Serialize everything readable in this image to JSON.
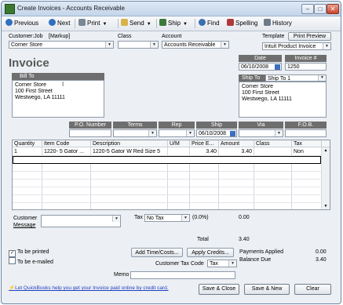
{
  "window": {
    "title": "Create Invoices - Accounts Receivable",
    "controls": {
      "minimize": "–",
      "maximize": "□",
      "close": "✕"
    }
  },
  "toolbar": {
    "previous": "Previous",
    "next": "Next",
    "print": "Print",
    "send": "Send",
    "ship": "Ship",
    "find": "Find",
    "spelling": "Spelling",
    "history": "History"
  },
  "header": {
    "customer_job_label": "Customer:Job",
    "markup_label": "[Markup]",
    "customer_job_value": "Corner Store",
    "class_label": "Class",
    "class_value": "",
    "account_label": "Account",
    "account_value": "Accounts Receivable",
    "template_label": "Template",
    "print_preview": "Print Preview",
    "template_value": "Intuit Product Invoice"
  },
  "invoice": {
    "title": "Invoice",
    "date_label": "Date",
    "date_value": "06/10/2008",
    "number_label": "Invoice #",
    "number_value": "1250",
    "bill_to_label": "Bill To",
    "bill_to_lines": [
      "Corner Store",
      "100 First Street",
      "Westwego, LA 11111"
    ],
    "ship_to_label": "Ship To",
    "ship_to_value": "Ship To 1",
    "ship_to_lines": [
      "Corner Store",
      "100 First Street",
      "Westwego, LA 11111"
    ]
  },
  "terms_row": {
    "po_number_label": "P.O. Number",
    "terms_label": "Terms",
    "rep_label": "Rep",
    "ship_label": "Ship",
    "via_label": "Via",
    "fob_label": "F.O.B.",
    "ship_value": "06/10/2008"
  },
  "grid": {
    "columns": [
      "Quantity",
      "Item Code",
      "Description",
      "U/M",
      "Price E...",
      "Amount",
      "Class",
      "Tax"
    ],
    "rows": [
      {
        "quantity": "1",
        "item_code": "1220- 5 Gator ...",
        "description": "1220-5 Gator W Red Size 5",
        "um": "",
        "price": "3.40",
        "amount": "3.40",
        "class": "",
        "tax": "Non"
      }
    ]
  },
  "footer": {
    "customer_message_label": "Customer Message",
    "customer_message_lines": [
      "Customer",
      "Message"
    ],
    "tax_label": "Tax",
    "tax_value": "No Tax",
    "tax_rate": "(0.0%)",
    "tax_amount": "0.00",
    "total_label": "Total",
    "total_value": "3.40",
    "to_be_printed": "To be printed",
    "to_be_emailed": "To be e-mailed",
    "add_time_costs": "Add Time/Costs...",
    "apply_credits": "Apply Credits...",
    "payments_applied_label": "Payments Applied",
    "payments_applied_value": "0.00",
    "customer_tax_code_label": "Customer Tax Code",
    "customer_tax_code_value": "Tax",
    "balance_due_label": "Balance Due",
    "balance_due_value": "3.40",
    "memo_label": "Memo",
    "memo_value": "",
    "quickbooks_link": "Let QuickBooks help you get your Invoice paid online by credit card.",
    "save_close": "Save & Close",
    "save_new": "Save & New",
    "clear": "Clear"
  },
  "colors": {
    "label_bar": "#6e6e6e",
    "invoice_title": "#5a5a5a",
    "link": "#1f3fbf",
    "window_bg": "#eceff3"
  }
}
